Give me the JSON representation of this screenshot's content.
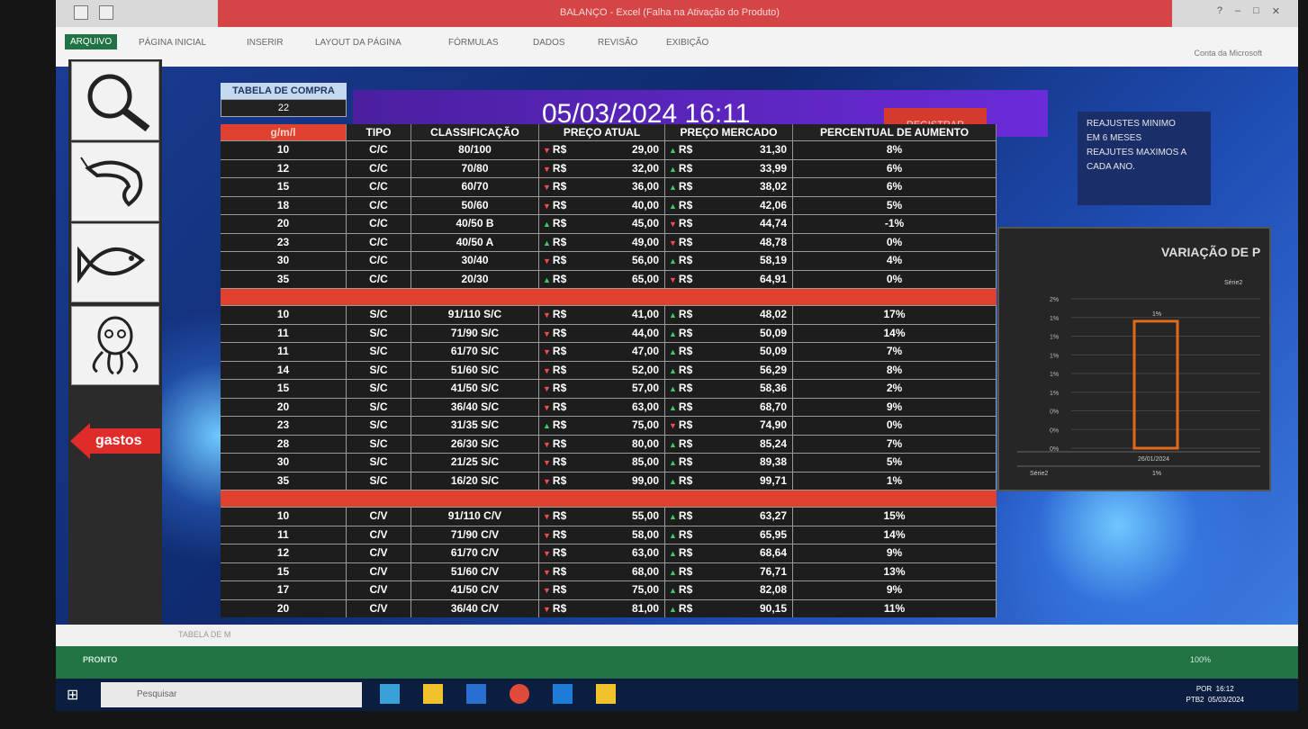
{
  "window": {
    "title": "BALANÇO - Excel (Falha na Ativação do Produto)",
    "ribbon_tabs": [
      "ARQUIVO",
      "PÁGINA INICIAL",
      "INSERIR",
      "LAYOUT DA PÁGINA",
      "FÓRMULAS",
      "DADOS",
      "REVISÃO",
      "EXIBIÇÃO"
    ],
    "account": "Conta da Microsoft"
  },
  "sidebar": {
    "icons": [
      "magnifier-icon",
      "shrimp-icon",
      "fish-icon",
      "octopus-icon"
    ],
    "gastos_label": "gastos"
  },
  "header": {
    "tabela_label": "TABELA DE COMPRA",
    "tabela_value": "22",
    "datetime": "05/03/2024 16:11",
    "register_label": "REGISTRAR",
    "note_lines": [
      "REAJUSTES MINIMO",
      "EM 6 MESES",
      "REAJUTES MAXIMOS A",
      "CADA ANO."
    ]
  },
  "table": {
    "columns": [
      "g/m/l",
      "TIPO",
      "CLASSIFICAÇÃO",
      "PREÇO ATUAL",
      "PREÇO MERCADO",
      "PERCENTUAL DE AUMENTO"
    ],
    "currency": "R$",
    "groups": [
      [
        [
          "10",
          "C/C",
          "80/100",
          "dn",
          "29,00",
          "up",
          "31,30",
          "8%"
        ],
        [
          "12",
          "C/C",
          "70/80",
          "dn",
          "32,00",
          "up",
          "33,99",
          "6%"
        ],
        [
          "15",
          "C/C",
          "60/70",
          "dn",
          "36,00",
          "up",
          "38,02",
          "6%"
        ],
        [
          "18",
          "C/C",
          "50/60",
          "dn",
          "40,00",
          "up",
          "42,06",
          "5%"
        ],
        [
          "20",
          "C/C",
          "40/50 B",
          "up",
          "45,00",
          "dn",
          "44,74",
          "-1%"
        ],
        [
          "23",
          "C/C",
          "40/50 A",
          "up",
          "49,00",
          "dn",
          "48,78",
          "0%"
        ],
        [
          "30",
          "C/C",
          "30/40",
          "dn",
          "56,00",
          "up",
          "58,19",
          "4%"
        ],
        [
          "35",
          "C/C",
          "20/30",
          "up",
          "65,00",
          "dn",
          "64,91",
          "0%"
        ]
      ],
      [
        [
          "10",
          "S/C",
          "91/110 S/C",
          "dn",
          "41,00",
          "up",
          "48,02",
          "17%"
        ],
        [
          "11",
          "S/C",
          "71/90 S/C",
          "dn",
          "44,00",
          "up",
          "50,09",
          "14%"
        ],
        [
          "11",
          "S/C",
          "61/70 S/C",
          "dn",
          "47,00",
          "up",
          "50,09",
          "7%"
        ],
        [
          "14",
          "S/C",
          "51/60 S/C",
          "dn",
          "52,00",
          "up",
          "56,29",
          "8%"
        ],
        [
          "15",
          "S/C",
          "41/50 S/C",
          "dn",
          "57,00",
          "up",
          "58,36",
          "2%"
        ],
        [
          "20",
          "S/C",
          "36/40 S/C",
          "dn",
          "63,00",
          "up",
          "68,70",
          "9%"
        ],
        [
          "23",
          "S/C",
          "31/35 S/C",
          "up",
          "75,00",
          "dn",
          "74,90",
          "0%"
        ],
        [
          "28",
          "S/C",
          "26/30 S/C",
          "dn",
          "80,00",
          "up",
          "85,24",
          "7%"
        ],
        [
          "30",
          "S/C",
          "21/25 S/C",
          "dn",
          "85,00",
          "up",
          "89,38",
          "5%"
        ],
        [
          "35",
          "S/C",
          "16/20 S/C",
          "dn",
          "99,00",
          "up",
          "99,71",
          "1%"
        ]
      ],
      [
        [
          "10",
          "C/V",
          "91/110 C/V",
          "dn",
          "55,00",
          "up",
          "63,27",
          "15%"
        ],
        [
          "11",
          "C/V",
          "71/90 C/V",
          "dn",
          "58,00",
          "up",
          "65,95",
          "14%"
        ],
        [
          "12",
          "C/V",
          "61/70 C/V",
          "dn",
          "63,00",
          "up",
          "68,64",
          "9%"
        ],
        [
          "15",
          "C/V",
          "51/60 C/V",
          "dn",
          "68,00",
          "up",
          "76,71",
          "13%"
        ],
        [
          "17",
          "C/V",
          "41/50 C/V",
          "dn",
          "75,00",
          "up",
          "82,08",
          "9%"
        ],
        [
          "20",
          "C/V",
          "36/40 C/V",
          "dn",
          "81,00",
          "up",
          "90,15",
          "11%"
        ]
      ]
    ]
  },
  "chart_data": {
    "type": "bar",
    "title": "VARIAÇÃO DE P",
    "categories": [
      "26/01/2024"
    ],
    "series": [
      {
        "name": "Série2",
        "values": [
          1
        ]
      }
    ],
    "y_tick_labels": [
      "2%",
      "1%",
      "1%",
      "1%",
      "1%",
      "1%",
      "0%",
      "0%",
      "0%"
    ],
    "data_labels": [
      "1%"
    ],
    "table_values": [
      "1%"
    ],
    "bar_color": "#e26a1b"
  },
  "statusbar": {
    "status": "PRONTO",
    "zoom": "100%",
    "sheet_tab": "TABELA DE M"
  },
  "taskbar": {
    "search_placeholder": "Pesquisar",
    "lang": "POR",
    "lang2": "PTB2",
    "time": "16:12",
    "date": "05/03/2024"
  }
}
